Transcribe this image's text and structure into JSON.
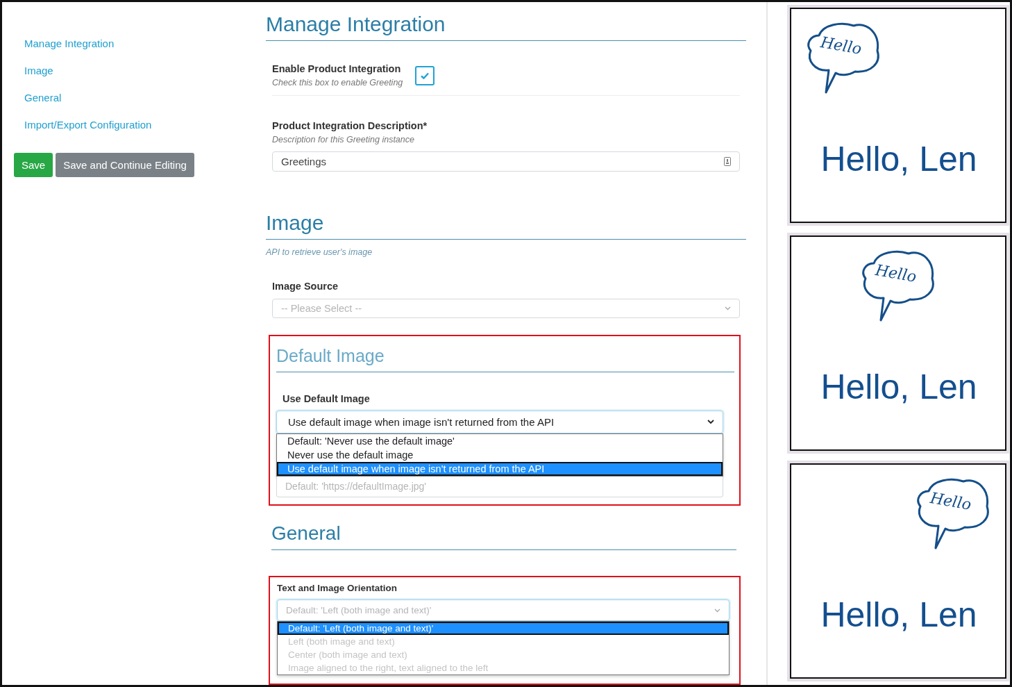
{
  "sidebar": {
    "items": [
      {
        "label": "Manage Integration"
      },
      {
        "label": "Image"
      },
      {
        "label": "General"
      },
      {
        "label": "Import/Export Configuration"
      }
    ],
    "buttons": [
      {
        "label": "Save",
        "kind": "primary"
      },
      {
        "label": "Save and Continue Editing",
        "kind": "secondary"
      }
    ]
  },
  "manage_integration": {
    "title": "Manage Integration",
    "enable": {
      "label": "Enable Product Integration",
      "help": "Check this box to enable Greeting",
      "checked": true
    },
    "description": {
      "label": "Product Integration Description*",
      "help": "Description for this Greeting instance",
      "value": "Greetings"
    }
  },
  "image": {
    "title": "Image",
    "subtitle": "API to retrieve user's image",
    "source": {
      "label": "Image Source",
      "placeholder": "-- Please Select --"
    }
  },
  "default_image": {
    "title": "Default Image",
    "label": "Use Default Image",
    "value": "Use default image when image isn't returned from the API",
    "options": [
      {
        "label": "Default: 'Never use the default image'",
        "selected": false,
        "disabled": false
      },
      {
        "label": "Never use the default image",
        "selected": false,
        "disabled": false
      },
      {
        "label": "Use default image when image isn't returned from the API",
        "selected": true,
        "disabled": false
      }
    ],
    "url_placeholder": "Default: 'https://defaultImage.jpg'"
  },
  "general": {
    "title": "General",
    "orientation": {
      "label": "Text and Image Orientation",
      "placeholder": "Default: 'Left (both image and text)'",
      "options": [
        {
          "label": "Default: 'Left (both image and text)'",
          "selected": true,
          "disabled": false
        },
        {
          "label": "Left (both image and text)",
          "selected": false,
          "disabled": true
        },
        {
          "label": "Center (both image and text)",
          "selected": false,
          "disabled": true
        },
        {
          "label": "Image aligned to the right, text aligned to the left",
          "selected": false,
          "disabled": true
        }
      ]
    }
  },
  "previews": [
    {
      "kind": "left",
      "bubble": "Hello",
      "greeting": "Hello, Len"
    },
    {
      "kind": "center",
      "bubble": "Hello",
      "greeting": "Hello, Len"
    },
    {
      "kind": "right",
      "bubble": "Hello",
      "greeting": "Hello, Len"
    }
  ]
}
